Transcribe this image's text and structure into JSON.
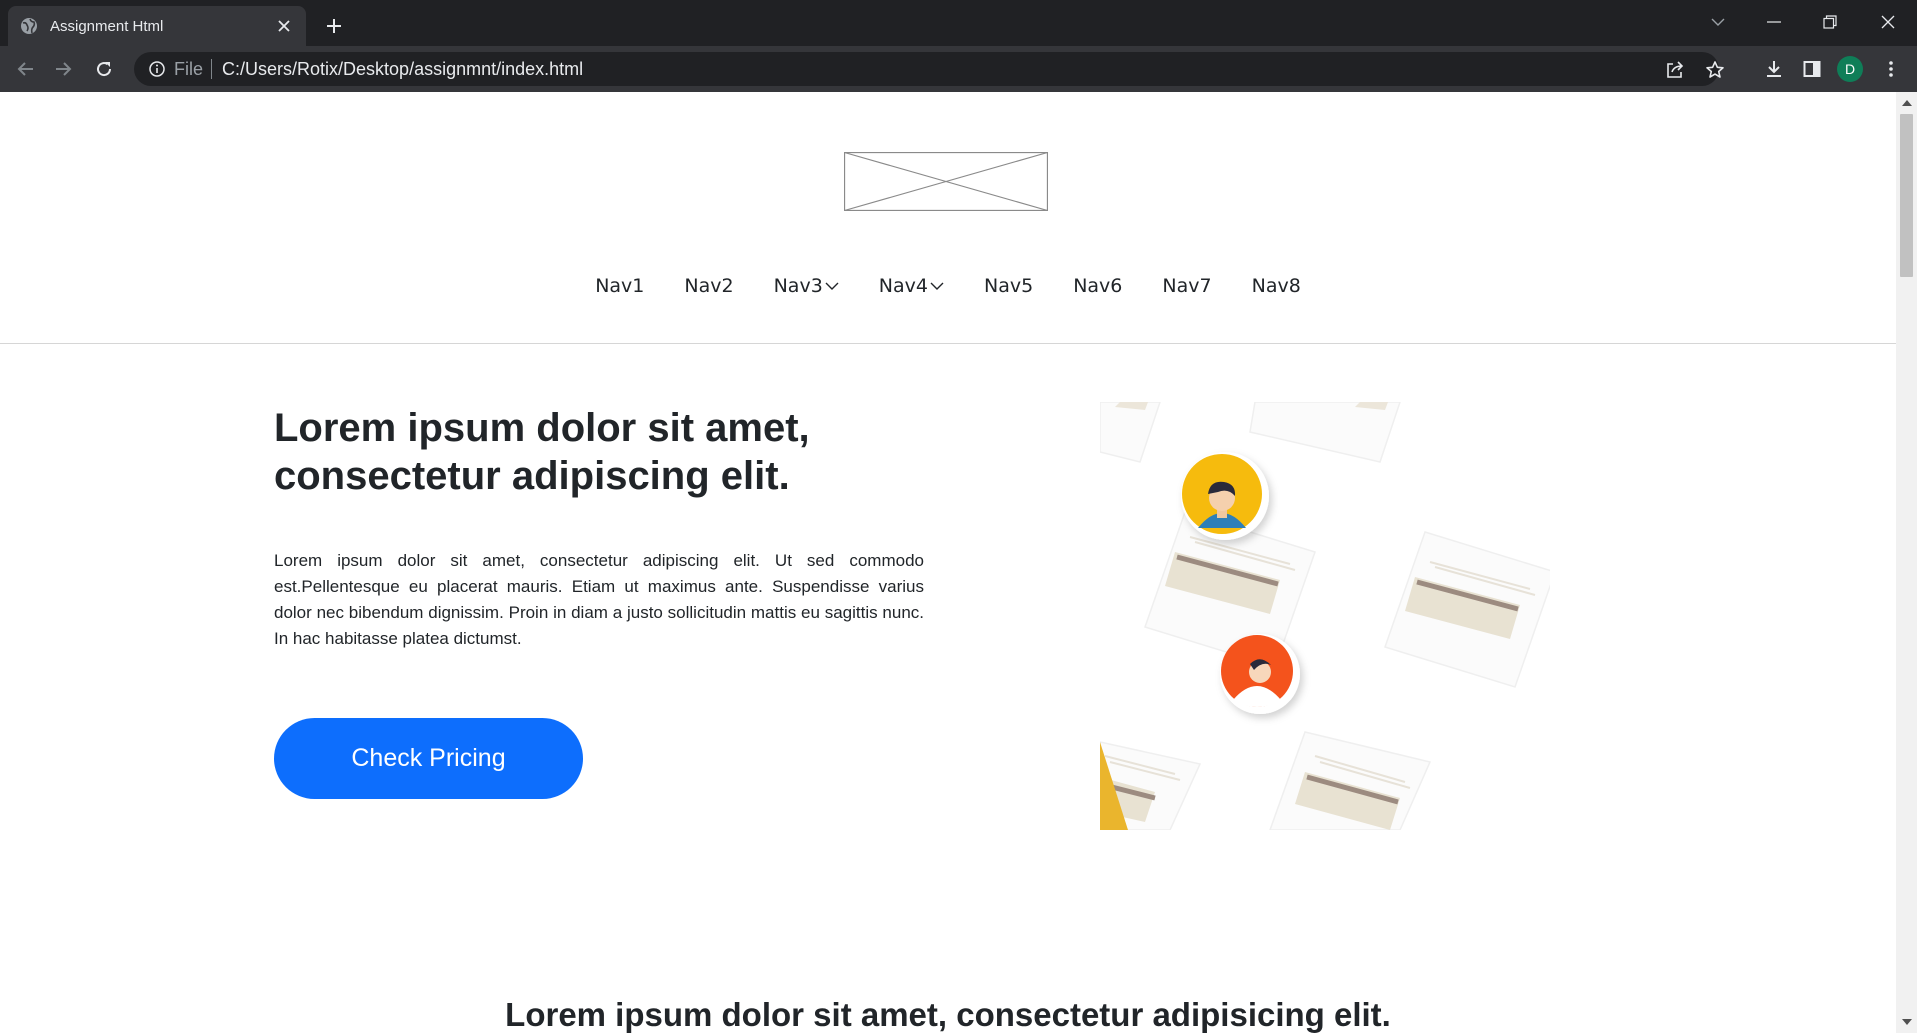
{
  "browser": {
    "tab_title": "Assignment Html",
    "omnibox_scheme": "File",
    "omnibox_url": "C:/Users/Rotix/Desktop/assignmnt/index.html",
    "profile_initial": "D",
    "profile_color": "#0f7e58"
  },
  "nav": {
    "items": [
      {
        "label": "Nav1",
        "dropdown": false
      },
      {
        "label": "Nav2",
        "dropdown": false
      },
      {
        "label": "Nav3",
        "dropdown": true
      },
      {
        "label": "Nav4",
        "dropdown": true
      },
      {
        "label": "Nav5",
        "dropdown": false
      },
      {
        "label": "Nav6",
        "dropdown": false
      },
      {
        "label": "Nav7",
        "dropdown": false
      },
      {
        "label": "Nav8",
        "dropdown": false
      }
    ]
  },
  "hero": {
    "title": "Lorem ipsum dolor sit amet, consectetur adipiscing elit.",
    "body": "Lorem ipsum dolor sit amet, consectetur adipiscing elit. Ut sed commodo est.Pellentesque eu placerat mauris. Etiam ut maximus ante. Suspendisse varius dolor nec bibendum dignissim. Proin in diam a justo sollicitudin mattis eu sagittis nunc. In hac habitasse platea dictumst.",
    "cta_label": "Check Pricing",
    "cta_color": "#0d6efd"
  },
  "section": {
    "title": "Lorem ipsum dolor sit amet, consectetur adipisicing elit."
  }
}
